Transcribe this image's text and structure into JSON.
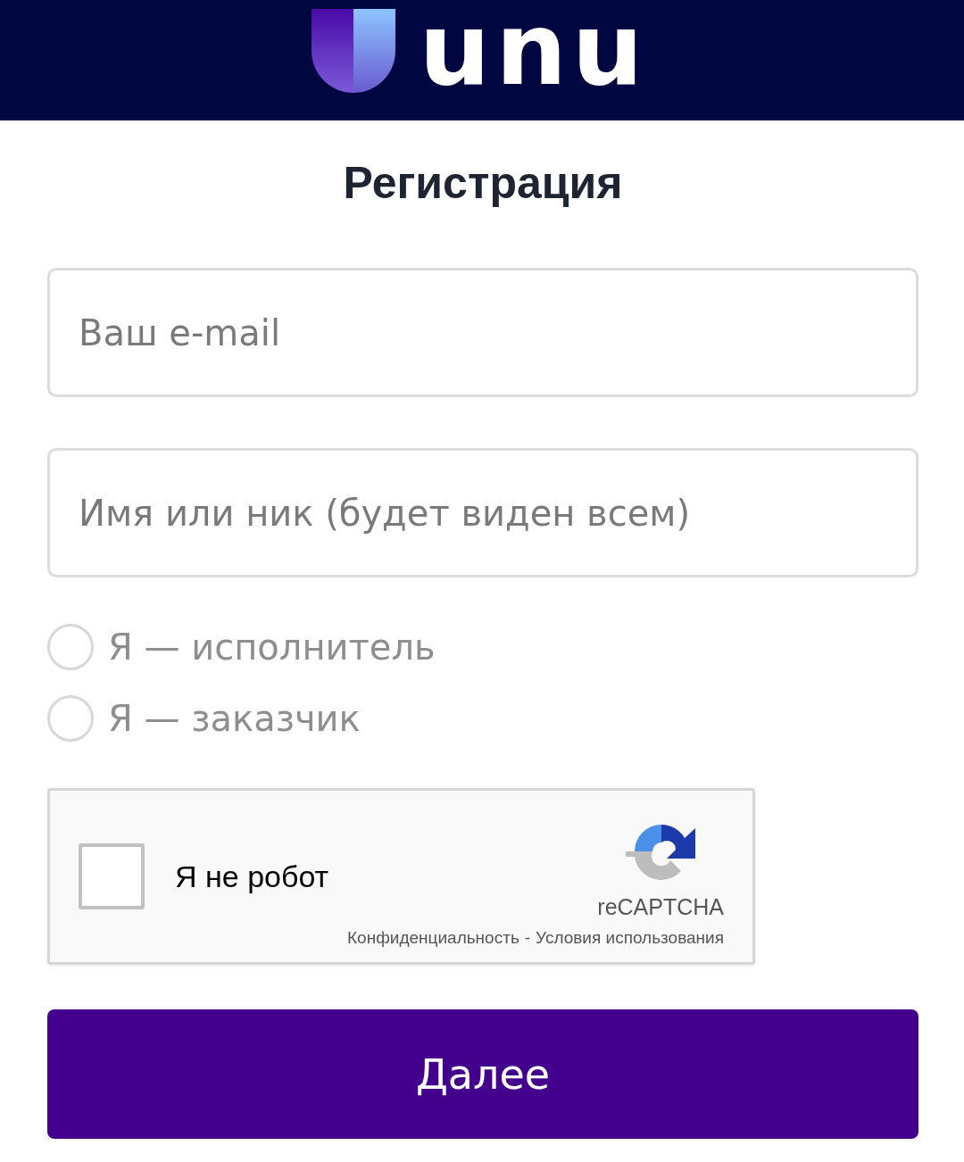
{
  "header": {
    "logo_text": "unu"
  },
  "title": "Регистрация",
  "fields": [
    {
      "placeholder": "Ваш e-mail"
    },
    {
      "placeholder": "Имя или ник (будет виден всем)"
    }
  ],
  "roles": [
    {
      "label": "Я — исполнитель",
      "selected": false
    },
    {
      "label": "Я — заказчик",
      "selected": false
    }
  ],
  "captcha": {
    "label": "Я не робот",
    "checked": false,
    "brand": "reCAPTCHA",
    "links": [
      "Конфиденциальность",
      "Условия использования"
    ],
    "separator": "-"
  },
  "submit": "Далее"
}
